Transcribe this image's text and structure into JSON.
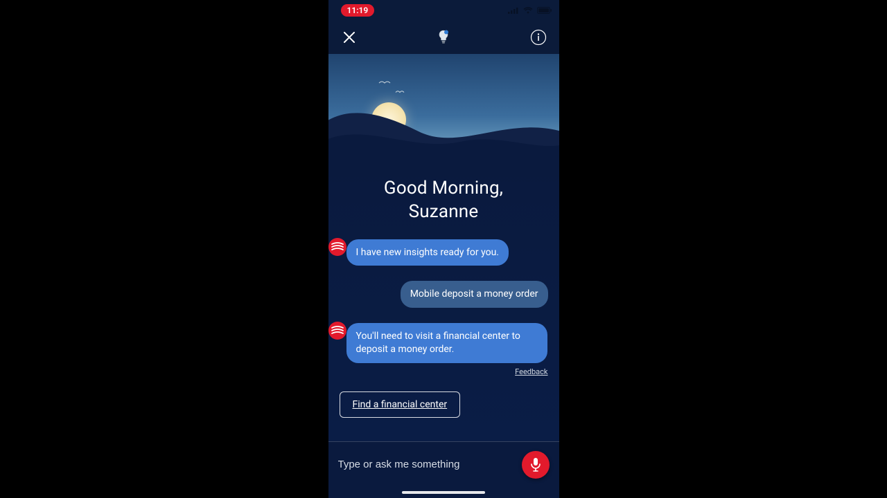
{
  "statusbar": {
    "time": "11:19"
  },
  "header": {
    "close_icon_name": "close-icon",
    "lightbulb_icon_name": "lightbulb-icon",
    "info_icon_name": "info-icon"
  },
  "greeting": {
    "line1": "Good Morning,",
    "line2": "Suzanne"
  },
  "messages": {
    "bot1": "I have new insights ready for you.",
    "user1": "Mobile deposit a money order",
    "bot2": "You'll need to visit a financial center to deposit a money order."
  },
  "feedback_label": "Feedback",
  "action_button": "Find a financial center",
  "input": {
    "placeholder": "Type or ask me something"
  },
  "colors": {
    "accent_red": "#e21a2c",
    "bot_bubble": "#3f7bd4",
    "user_bubble": "#385e8e"
  }
}
